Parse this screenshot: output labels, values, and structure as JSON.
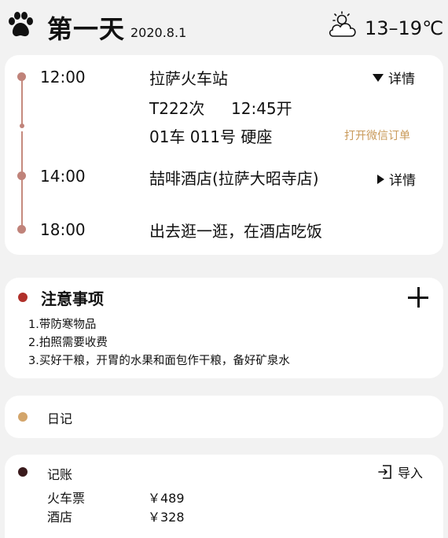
{
  "header": {
    "paw_icon": "paw-icon",
    "day_title": "第一天",
    "date": "2020.8.1",
    "weather_icon": "partly-cloudy-icon",
    "temperature": "13–19℃"
  },
  "itinerary": {
    "accent_color": "#c0837a",
    "items": [
      {
        "time": "12:00",
        "place": "拉萨火车站",
        "train": "T222次",
        "depart": "12:45开",
        "seat": "01车 011号 硬座",
        "detail_label": "详情",
        "wechat_label": "打开微信订单"
      },
      {
        "time": "14:00",
        "place": "喆啡酒店(拉萨大昭寺店)",
        "detail_label": "详情"
      },
      {
        "time": "18:00",
        "place": "出去逛一逛，在酒店吃饭"
      }
    ]
  },
  "notes": {
    "title": "注意事项",
    "dot_color": "#b0302a",
    "items": [
      "1.带防寒物品",
      "2.拍照需要收费",
      "3.买好干粮，开胃的水果和面包作干粮，备好矿泉水"
    ]
  },
  "diary": {
    "title": "日记",
    "dot_color": "#d3a56b"
  },
  "accounts": {
    "title": "记账",
    "dot_color": "#3a1a1c",
    "import_label": "导入",
    "entries": [
      {
        "name": "火车票",
        "amount": "￥489"
      },
      {
        "name": "酒店",
        "amount": "￥328"
      }
    ]
  }
}
